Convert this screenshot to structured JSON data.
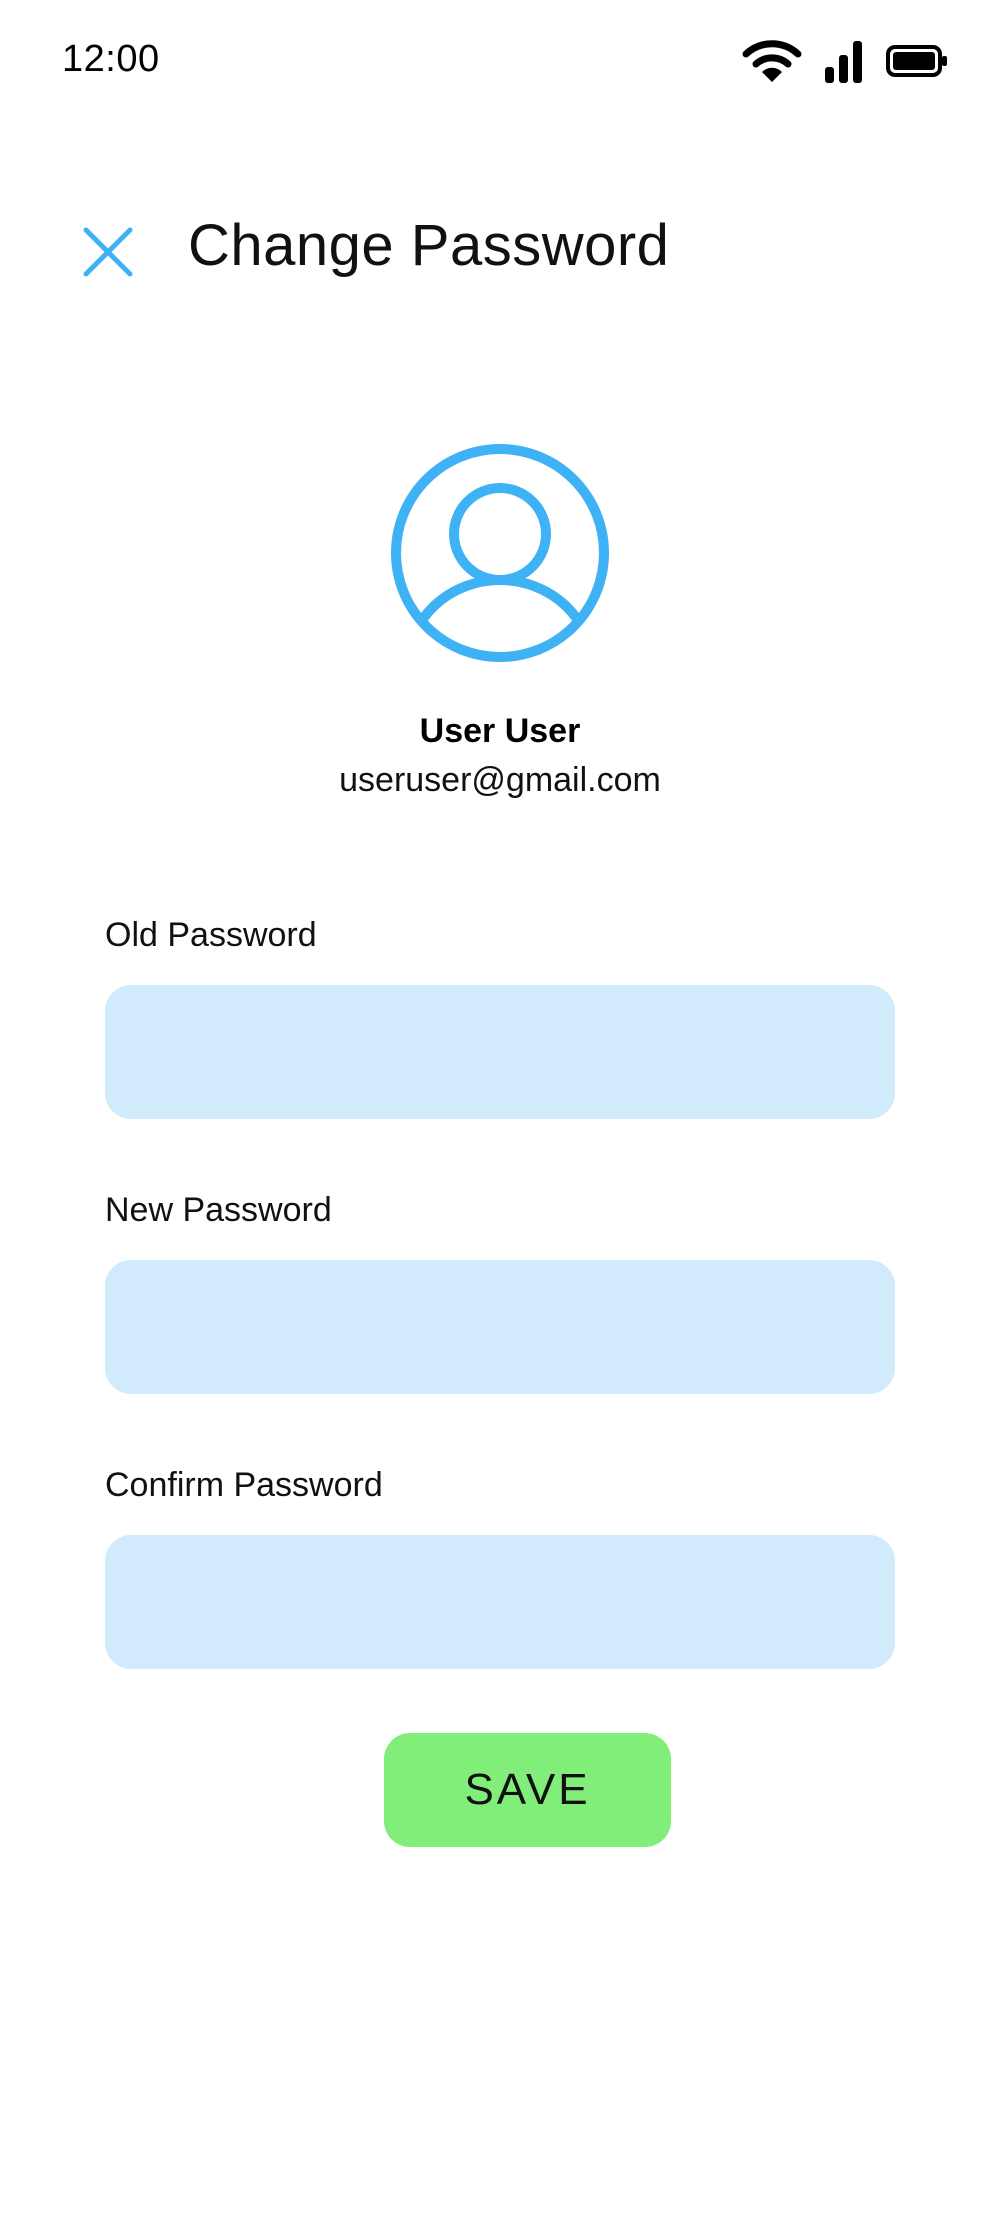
{
  "status_bar": {
    "time": "12:00",
    "icons": [
      "wifi-icon",
      "cellular-signal-icon",
      "battery-icon"
    ]
  },
  "header": {
    "title": "Change Password",
    "close_icon": "close-icon"
  },
  "profile": {
    "avatar_icon": "user-avatar-icon",
    "name": "User User",
    "email": "useruser@gmail.com"
  },
  "form": {
    "old_password": {
      "label": "Old Password",
      "value": "",
      "placeholder": ""
    },
    "new_password": {
      "label": "New Password",
      "value": "",
      "placeholder": ""
    },
    "confirm_password": {
      "label": "Confirm Password",
      "value": "",
      "placeholder": ""
    }
  },
  "actions": {
    "save_label": "SAVE"
  },
  "colors": {
    "accent": "#3fb1f5",
    "input_background": "#d1eafc",
    "save_button": "#80ee79",
    "text": "#111111"
  }
}
